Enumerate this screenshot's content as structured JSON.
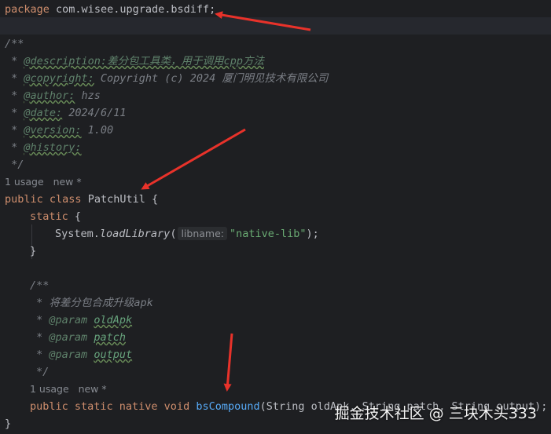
{
  "editor": {
    "package_kw": "package",
    "package_name": "com.wisee.upgrade.bsdiff;",
    "doc_open": "/**",
    "doc_prefix": " * ",
    "description_tag": "@description:",
    "description_text": "差分包工具类，用于调用cpp方法",
    "copyright_tag": "@copyright:",
    "copyright_text": " Copyright (c) 2024 厦门明见技术有限公司",
    "author_tag": "@author:",
    "author_text": " hzs",
    "date_tag": "@date:",
    "date_text": " 2024/6/11",
    "version_tag": "@version:",
    "version_text": " 1.00",
    "history_tag": "@history:",
    "doc_close": " */",
    "usage_class": "1 usage   new *",
    "kw_public": "public",
    "kw_class": "class",
    "class_name": "PatchUtil",
    "open_brace": " {",
    "kw_static": "static",
    "static_brace": " {",
    "system": "System.",
    "load_library": "loadLibrary",
    "paren_open": "(",
    "hint_libname": "libname:",
    "lib_string": "\"native-lib\"",
    "paren_close": ");",
    "close_brace": "}",
    "doc2_open": "/**",
    "doc2_desc": "将差分包合成升级apk",
    "param_tag": "@param",
    "param_old": "oldApk",
    "param_patch": "patch",
    "param_output": "output",
    "doc2_close": "*/",
    "usage_method": "1 usage   new *",
    "method_mods": "public static native void",
    "method_name": "bsCompound",
    "method_args": "(String oldApk, String patch, String output);",
    "final_brace": "}"
  },
  "watermark": "掘金技术社区 @ 三块木头333",
  "colors": {
    "background": "#1e1f22",
    "keyword": "#cf8e6d",
    "comment": "#7a7e85",
    "string": "#6aab73",
    "method": "#57aaf7",
    "arrow": "#e8322a"
  }
}
